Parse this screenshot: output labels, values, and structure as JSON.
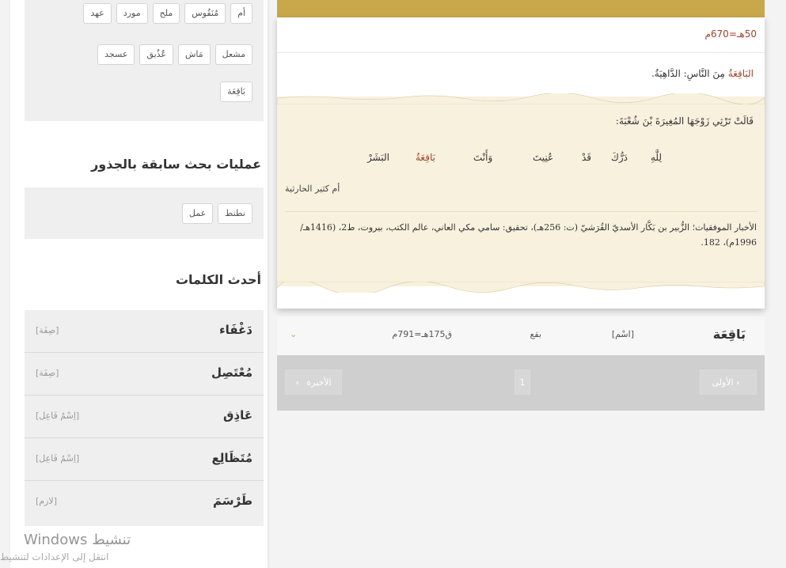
{
  "sidebar": {
    "related_roots": {
      "rows": [
        [
          "أم",
          "مُنَقُوس",
          "ملح",
          "مورد",
          "عهد"
        ],
        [
          "مشعل",
          "مَاش",
          "عُذُيق",
          "عسجد"
        ],
        [
          "بَاقِعَة"
        ]
      ]
    },
    "previous_searches": {
      "title": "عمليات بحث سابقة بالجذور",
      "tags": [
        "نطنط",
        "عمل"
      ]
    },
    "latest_words": {
      "title": "أحدث الكلمات",
      "items": [
        {
          "word": "دَغْفَاء",
          "type": "[صِفَة]"
        },
        {
          "word": "مُعْتَصِل",
          "type": "[صِفَة]"
        },
        {
          "word": "عَاذِق",
          "type": "[اِسْمُ فَاعِل]"
        },
        {
          "word": "مُتَظَالِع",
          "type": "[اِسْمُ فَاعِل]"
        },
        {
          "word": "طَرْسَمَ",
          "type": "[لازم]"
        }
      ]
    }
  },
  "os_overlay": {
    "title": "تنشيط Windows",
    "subtitle": "انتقل إلى الإعدادات لتنشيط"
  },
  "card": {
    "date": "50هـ=670م",
    "meaning_head": "البَاقِعَةُ",
    "meaning_tail": " مِنَ النَّاسِ: الدَّاهِيَةُ.",
    "intro": "قَالَتْ تَرْثِي زَوْجَهَا المُغِيرَةَ بْنَ شُعْبَةَ:",
    "verse": [
      "لِلَّهِ",
      "دَرُّكَ",
      "قَدْ",
      "عُنِيتَ",
      "وَأَنْتَ",
      "بَاقِعَةُ",
      "البَشَرْ"
    ],
    "poet": "أم كثير الحارثية",
    "source": "الأخبار الموفقيات؛ الزُّبير بن بَكَّار الأسديّ القُرَشيّ (ت: 256هـ)، تحقيق: سامي مكي العاني، عالم الكتب، بيروت، ط2، (1416هـ/ 1996م)، 182."
  },
  "result": {
    "word": "بَاقِعَة",
    "type": "[اسْم]",
    "root": "بقع",
    "date": "ق175هـ=791م"
  },
  "pagination": {
    "first": "الأولى",
    "page": "1",
    "last": "الأخيرة"
  }
}
